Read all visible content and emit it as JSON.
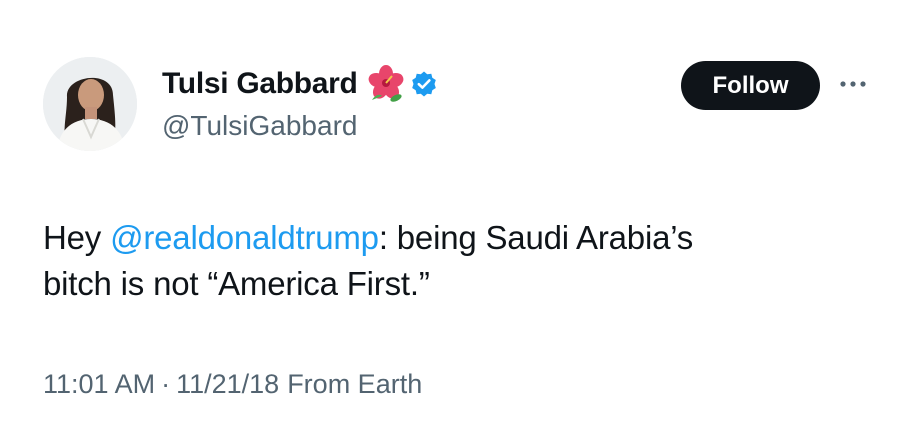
{
  "author": {
    "display_name": "Tulsi Gabbard",
    "handle": "@TulsiGabbard",
    "name_emoji": "hibiscus-icon",
    "verified": true,
    "verified_color": "#1d9bf0"
  },
  "actions": {
    "follow_label": "Follow",
    "more_icon": "more-horizontal-icon"
  },
  "tweet": {
    "text_before_mention": "Hey ",
    "mention": "@realdonaldtrump",
    "text_after_mention_line1": ": being Saudi Arabia’s",
    "text_line2": "bitch is not “America First.”"
  },
  "meta": {
    "time": "11:01 AM",
    "separator": "·",
    "date": "11/21/18",
    "source": "From Earth"
  },
  "colors": {
    "text": "#0f1419",
    "secondary": "#536471",
    "link": "#1d9bf0",
    "button_bg": "#0f1419"
  }
}
